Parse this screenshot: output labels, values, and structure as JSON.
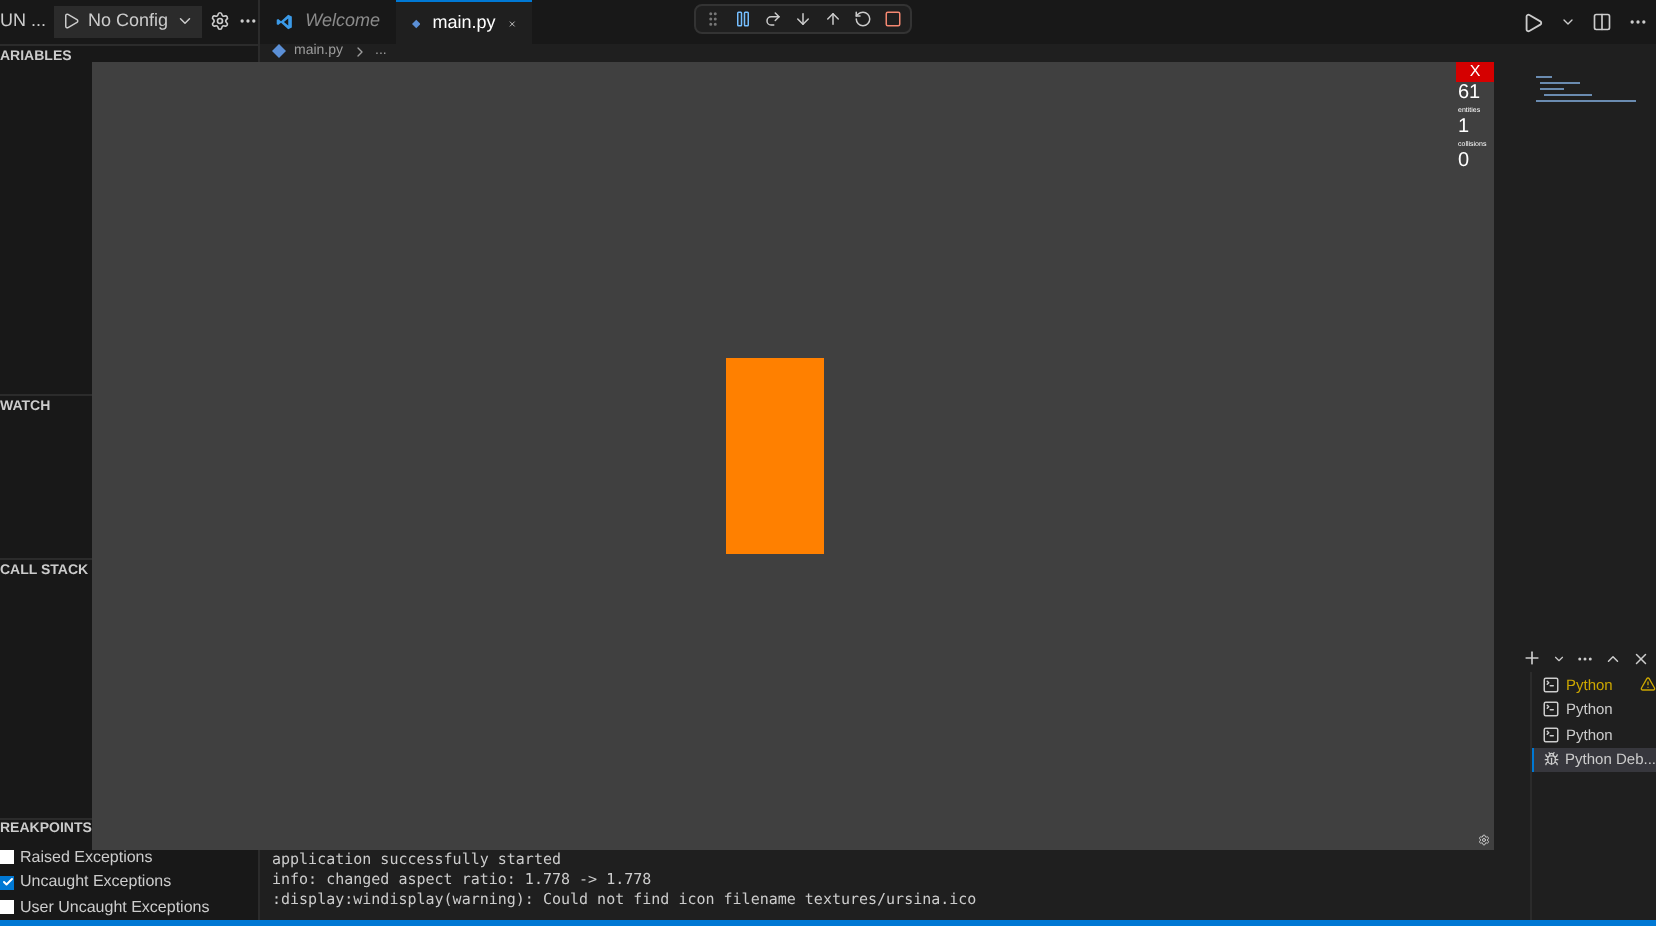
{
  "sidebar": {
    "title": "UN ...",
    "config": "No Config",
    "sections": [
      {
        "title": "ARIABLES"
      },
      {
        "title": "WATCH"
      },
      {
        "title": "CALL STACK"
      },
      {
        "title": "REAKPOINTS"
      }
    ],
    "breakpoints": [
      {
        "label": "Raised Exceptions",
        "checked": false
      },
      {
        "label": "Uncaught Exceptions",
        "checked": true
      },
      {
        "label": "User Uncaught Exceptions",
        "checked": false
      }
    ]
  },
  "tabs": [
    {
      "label": "Welcome",
      "kind": "welcome",
      "selected": false
    },
    {
      "label": "main.py",
      "kind": "python",
      "selected": true
    }
  ],
  "breadcrumb": [
    "main.py",
    "..."
  ],
  "terminal": {
    "lines": [
      "application successfully started",
      "info: changed aspect ratio: 1.778 -> 1.778",
      ":display:windisplay(warning): Could not find icon filename textures/ursina.ico"
    ],
    "sessions": [
      {
        "label": "Python",
        "kind": "shell",
        "warning": true,
        "selected": false
      },
      {
        "label": "Python",
        "kind": "shell",
        "warning": false,
        "selected": false
      },
      {
        "label": "Python",
        "kind": "shell",
        "warning": false,
        "selected": false
      },
      {
        "label": "Python Deb...",
        "kind": "debug",
        "warning": false,
        "selected": true
      }
    ]
  },
  "game_window": {
    "close": "X",
    "stats": [
      {
        "value": "61"
      },
      {
        "label": "entities",
        "value": "1"
      },
      {
        "label": "collisions",
        "value": "0"
      }
    ]
  }
}
